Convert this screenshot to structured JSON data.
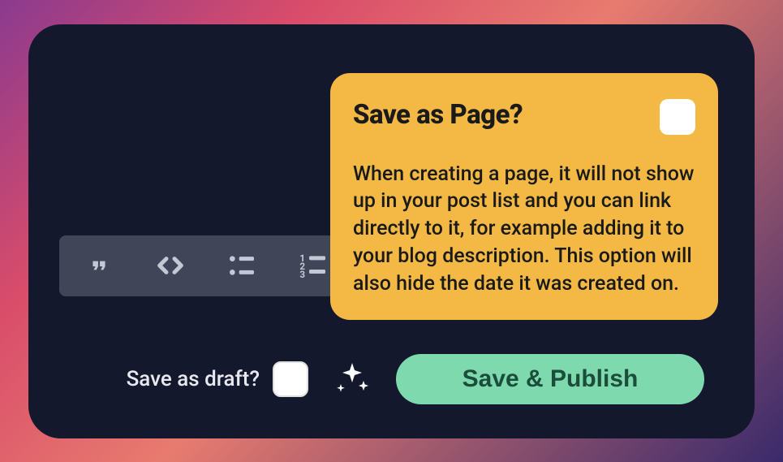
{
  "tooltip": {
    "title": "Save as Page?",
    "body": "When creating a page, it will not show up in your post list and you can link directly to it, for example adding it to your blog description. This option will also hide the date it was created on."
  },
  "draft": {
    "label": "Save as draft?"
  },
  "publish": {
    "label": "Save & Publish"
  },
  "icons": {
    "quote": "quote",
    "code": "code",
    "bullet_list": "bullet-list",
    "numbered_list": "numbered-list",
    "sparkle": "sparkle"
  }
}
